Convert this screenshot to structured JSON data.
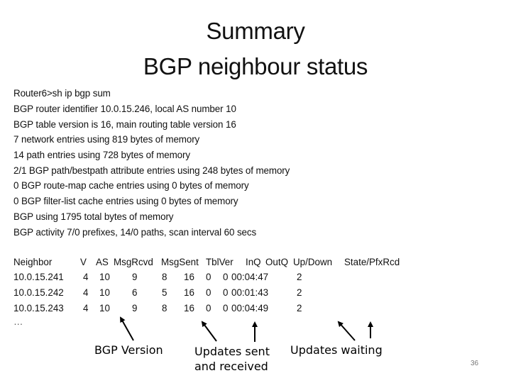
{
  "slide": {
    "title_line1": "Summary",
    "title_line2": "BGP neighbour status",
    "page_number": "36"
  },
  "output_lines": [
    "Router6>sh ip bgp sum",
    "BGP router identifier 10.0.15.246, local AS number 10",
    "BGP table version is 16, main routing table version 16",
    "7 network entries using 819 bytes of memory",
    "14 path entries using 728 bytes of memory",
    "2/1 BGP path/bestpath attribute entries using 248 bytes of memory",
    "0 BGP route-map cache entries using 0 bytes of memory",
    "0 BGP filter-list cache entries using 0 bytes of memory",
    "BGP using 1795 total bytes of memory",
    "BGP activity 7/0 prefixes, 14/0 paths, scan interval 60 secs"
  ],
  "neighbor_table": {
    "headers": [
      "Neighbor",
      "V",
      "AS",
      "MsgRcvd",
      "MsgSent",
      "TblVer",
      "InQ",
      "OutQ",
      "Up/Down",
      "State/PfxRcd"
    ],
    "rows": [
      {
        "neighbor": "10.0.15.241",
        "v": "4",
        "as": "10",
        "msgrcvd": "9",
        "msgsent": "8",
        "tblver": "16",
        "inq": "0",
        "outq": "0",
        "updown": "00:04:47",
        "pfxrcd": "2"
      },
      {
        "neighbor": "10.0.15.242",
        "v": "4",
        "as": "10",
        "msgrcvd": "6",
        "msgsent": "5",
        "tblver": "16",
        "inq": "0",
        "outq": "0",
        "updown": "00:01:43",
        "pfxrcd": "2"
      },
      {
        "neighbor": "10.0.15.243",
        "v": "4",
        "as": "10",
        "msgrcvd": "9",
        "msgsent": "8",
        "tblver": "16",
        "inq": "0",
        "outq": "0",
        "updown": "00:04:49",
        "pfxrcd": "2"
      }
    ],
    "ellipsis": "…"
  },
  "annotations": {
    "bgp_version": "BGP Version",
    "updates_sent_line1": "Updates sent",
    "updates_sent_line2": "and received",
    "updates_waiting": "Updates waiting"
  }
}
